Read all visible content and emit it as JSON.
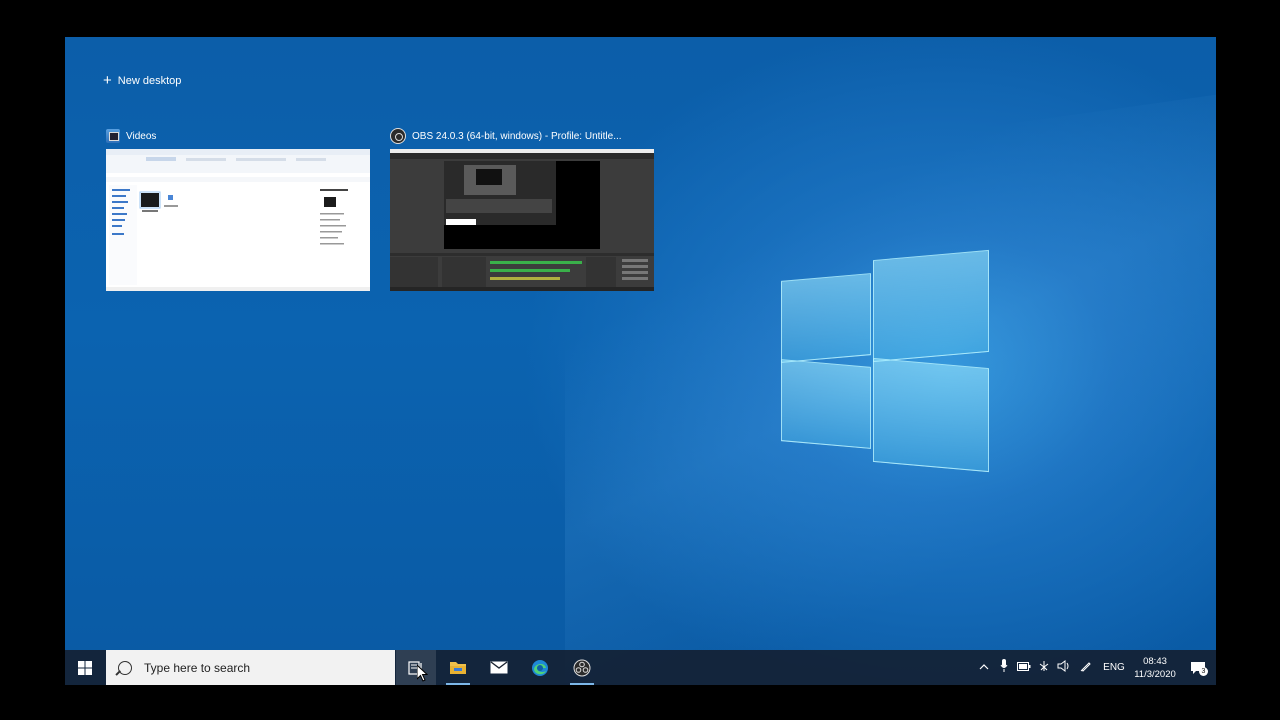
{
  "new_desktop": {
    "icon": "plus-icon",
    "label": "New desktop"
  },
  "windows": [
    {
      "app": "file-explorer",
      "icon": "videos-folder-icon",
      "title": "Videos"
    },
    {
      "app": "obs",
      "icon": "obs-icon",
      "title": "OBS 24.0.3 (64-bit, windows) - Profile: Untitle..."
    }
  ],
  "taskbar": {
    "search_placeholder": "Type here to search",
    "pinned": [
      "task-view-icon",
      "file-explorer-icon",
      "mail-icon",
      "edge-icon",
      "obs-icon"
    ],
    "tray": {
      "icons": [
        "chevron-up-icon",
        "microphone-icon",
        "battery-icon",
        "network-icon",
        "volume-icon",
        "pen-icon"
      ],
      "language": "ENG",
      "time": "08:43",
      "date": "11/3/2020",
      "notification_count": "3"
    }
  },
  "colors": {
    "desktop": "#0b63b0",
    "taskbar": "#141e2d",
    "accent": "#7cb7e8"
  }
}
